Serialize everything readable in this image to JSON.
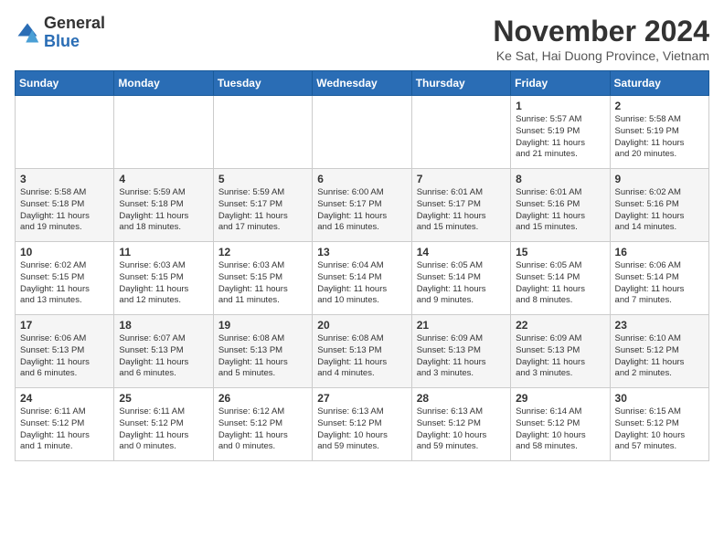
{
  "header": {
    "logo_general": "General",
    "logo_blue": "Blue",
    "month_year": "November 2024",
    "location": "Ke Sat, Hai Duong Province, Vietnam"
  },
  "days_of_week": [
    "Sunday",
    "Monday",
    "Tuesday",
    "Wednesday",
    "Thursday",
    "Friday",
    "Saturday"
  ],
  "weeks": [
    [
      {
        "day": "",
        "info": ""
      },
      {
        "day": "",
        "info": ""
      },
      {
        "day": "",
        "info": ""
      },
      {
        "day": "",
        "info": ""
      },
      {
        "day": "",
        "info": ""
      },
      {
        "day": "1",
        "info": "Sunrise: 5:57 AM\nSunset: 5:19 PM\nDaylight: 11 hours\nand 21 minutes."
      },
      {
        "day": "2",
        "info": "Sunrise: 5:58 AM\nSunset: 5:19 PM\nDaylight: 11 hours\nand 20 minutes."
      }
    ],
    [
      {
        "day": "3",
        "info": "Sunrise: 5:58 AM\nSunset: 5:18 PM\nDaylight: 11 hours\nand 19 minutes."
      },
      {
        "day": "4",
        "info": "Sunrise: 5:59 AM\nSunset: 5:18 PM\nDaylight: 11 hours\nand 18 minutes."
      },
      {
        "day": "5",
        "info": "Sunrise: 5:59 AM\nSunset: 5:17 PM\nDaylight: 11 hours\nand 17 minutes."
      },
      {
        "day": "6",
        "info": "Sunrise: 6:00 AM\nSunset: 5:17 PM\nDaylight: 11 hours\nand 16 minutes."
      },
      {
        "day": "7",
        "info": "Sunrise: 6:01 AM\nSunset: 5:17 PM\nDaylight: 11 hours\nand 15 minutes."
      },
      {
        "day": "8",
        "info": "Sunrise: 6:01 AM\nSunset: 5:16 PM\nDaylight: 11 hours\nand 15 minutes."
      },
      {
        "day": "9",
        "info": "Sunrise: 6:02 AM\nSunset: 5:16 PM\nDaylight: 11 hours\nand 14 minutes."
      }
    ],
    [
      {
        "day": "10",
        "info": "Sunrise: 6:02 AM\nSunset: 5:15 PM\nDaylight: 11 hours\nand 13 minutes."
      },
      {
        "day": "11",
        "info": "Sunrise: 6:03 AM\nSunset: 5:15 PM\nDaylight: 11 hours\nand 12 minutes."
      },
      {
        "day": "12",
        "info": "Sunrise: 6:03 AM\nSunset: 5:15 PM\nDaylight: 11 hours\nand 11 minutes."
      },
      {
        "day": "13",
        "info": "Sunrise: 6:04 AM\nSunset: 5:14 PM\nDaylight: 11 hours\nand 10 minutes."
      },
      {
        "day": "14",
        "info": "Sunrise: 6:05 AM\nSunset: 5:14 PM\nDaylight: 11 hours\nand 9 minutes."
      },
      {
        "day": "15",
        "info": "Sunrise: 6:05 AM\nSunset: 5:14 PM\nDaylight: 11 hours\nand 8 minutes."
      },
      {
        "day": "16",
        "info": "Sunrise: 6:06 AM\nSunset: 5:14 PM\nDaylight: 11 hours\nand 7 minutes."
      }
    ],
    [
      {
        "day": "17",
        "info": "Sunrise: 6:06 AM\nSunset: 5:13 PM\nDaylight: 11 hours\nand 6 minutes."
      },
      {
        "day": "18",
        "info": "Sunrise: 6:07 AM\nSunset: 5:13 PM\nDaylight: 11 hours\nand 6 minutes."
      },
      {
        "day": "19",
        "info": "Sunrise: 6:08 AM\nSunset: 5:13 PM\nDaylight: 11 hours\nand 5 minutes."
      },
      {
        "day": "20",
        "info": "Sunrise: 6:08 AM\nSunset: 5:13 PM\nDaylight: 11 hours\nand 4 minutes."
      },
      {
        "day": "21",
        "info": "Sunrise: 6:09 AM\nSunset: 5:13 PM\nDaylight: 11 hours\nand 3 minutes."
      },
      {
        "day": "22",
        "info": "Sunrise: 6:09 AM\nSunset: 5:13 PM\nDaylight: 11 hours\nand 3 minutes."
      },
      {
        "day": "23",
        "info": "Sunrise: 6:10 AM\nSunset: 5:12 PM\nDaylight: 11 hours\nand 2 minutes."
      }
    ],
    [
      {
        "day": "24",
        "info": "Sunrise: 6:11 AM\nSunset: 5:12 PM\nDaylight: 11 hours\nand 1 minute."
      },
      {
        "day": "25",
        "info": "Sunrise: 6:11 AM\nSunset: 5:12 PM\nDaylight: 11 hours\nand 0 minutes."
      },
      {
        "day": "26",
        "info": "Sunrise: 6:12 AM\nSunset: 5:12 PM\nDaylight: 11 hours\nand 0 minutes."
      },
      {
        "day": "27",
        "info": "Sunrise: 6:13 AM\nSunset: 5:12 PM\nDaylight: 10 hours\nand 59 minutes."
      },
      {
        "day": "28",
        "info": "Sunrise: 6:13 AM\nSunset: 5:12 PM\nDaylight: 10 hours\nand 59 minutes."
      },
      {
        "day": "29",
        "info": "Sunrise: 6:14 AM\nSunset: 5:12 PM\nDaylight: 10 hours\nand 58 minutes."
      },
      {
        "day": "30",
        "info": "Sunrise: 6:15 AM\nSunset: 5:12 PM\nDaylight: 10 hours\nand 57 minutes."
      }
    ]
  ]
}
